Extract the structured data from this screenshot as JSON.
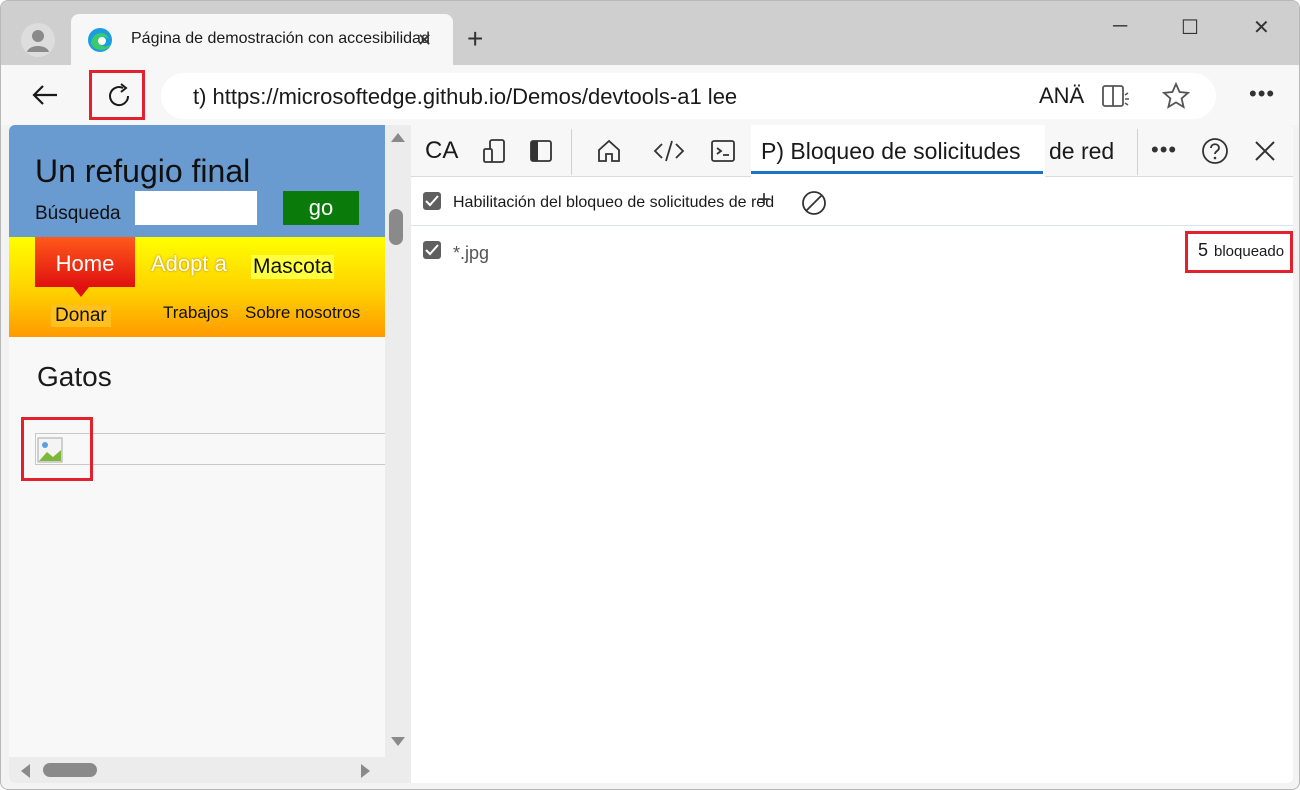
{
  "browser": {
    "tab_title": "Página de demostración con accesibilidad",
    "address_url": "t) https://microsoftedge.github.io/Demos/devtools-a1 lee",
    "read_aloud_label": "ANÄ"
  },
  "webpage": {
    "site_title": "Un refugio final",
    "search_label": "Búsqueda",
    "search_placeholder": "",
    "go_button": "go",
    "nav": {
      "home": "Home",
      "adopt": "Adopt a",
      "mascota": "Mascota",
      "donar": "Donar",
      "trabajos": "Trabajos",
      "sobre": "Sobre nosotros"
    },
    "section_title": "Gatos"
  },
  "devtools": {
    "ca_label": "CA",
    "active_tab_label": "P) Bloqueo de solicitudes",
    "active_tab_extra": "de red",
    "enable_label": "Habilitación del bloqueo de solicitudes de red",
    "pattern": "*.jpg",
    "blocked_count": "5",
    "blocked_label": "bloqueado"
  },
  "colors": {
    "highlight": "#e3212e",
    "header_blue": "#6a9bd0",
    "go_green": "#0a7a0a",
    "tab_underline": "#1a73c8"
  }
}
